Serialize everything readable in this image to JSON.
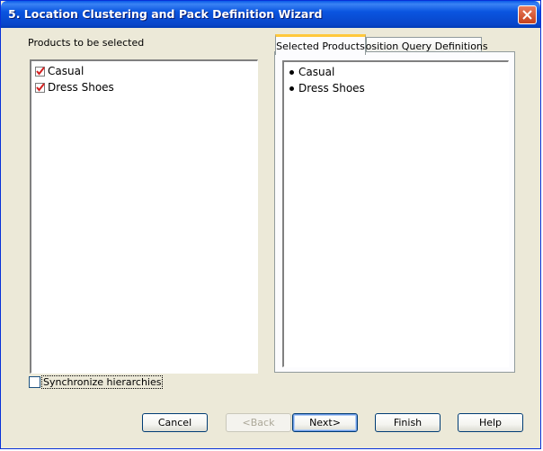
{
  "window": {
    "title": "5. Location Clustering and Pack Definition Wizard"
  },
  "left_panel": {
    "label": "Products to be selected",
    "items": [
      {
        "label": "Casual",
        "checked": true
      },
      {
        "label": "Dress Shoes",
        "checked": true
      }
    ],
    "sync_checkbox": {
      "label": "Synchronize hierarchies",
      "checked": false
    }
  },
  "tabs": [
    {
      "label": "Selected Products",
      "active": true
    },
    {
      "label": "Position Query Definitions",
      "active": false
    }
  ],
  "selected_products": {
    "items": [
      "Casual",
      "Dress Shoes"
    ]
  },
  "buttons": {
    "cancel": "Cancel",
    "back": "<Back",
    "next": "Next>",
    "finish": "Finish",
    "help": "Help"
  },
  "colors": {
    "titlebar": "#0a55e0",
    "dialog_bg": "#ece9d8",
    "check_mark": "#d42020",
    "tab_highlight": "#ffc83c"
  }
}
